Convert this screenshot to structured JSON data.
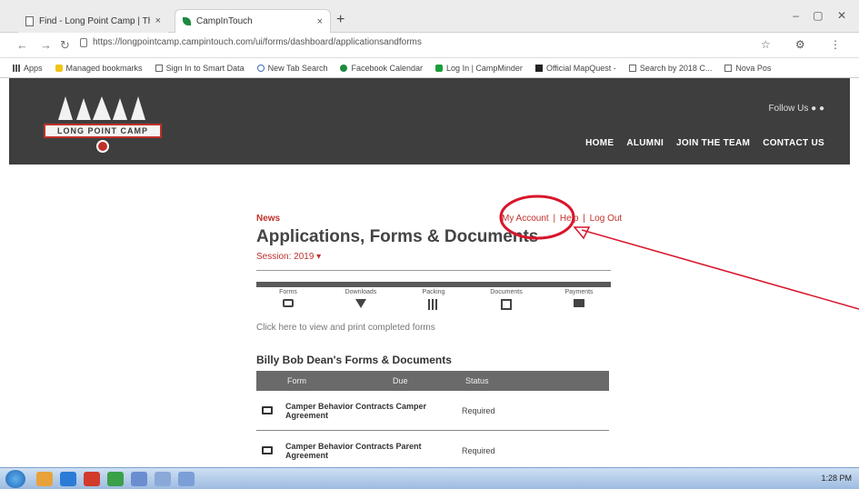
{
  "browser": {
    "tabs": [
      {
        "label": "Find - Long Point Camp | The"
      },
      {
        "label": "CampInTouch"
      }
    ],
    "url": "https://longpointcamp.campintouch.com/ui/forms/dashboard/applicationsandforms",
    "bookmarks": [
      {
        "label": "Apps",
        "icon": "apps-icon"
      },
      {
        "label": "Managed bookmarks",
        "icon": "folder-icon"
      },
      {
        "label": "Sign In to Smart Data",
        "icon": "doc-icon"
      },
      {
        "label": "New Tab Search",
        "icon": "search-icon"
      },
      {
        "label": "Facebook Calendar",
        "icon": "green-icon"
      },
      {
        "label": "Log In | CampMinder",
        "icon": "green-icon"
      },
      {
        "label": "Official MapQuest -",
        "icon": "map-icon"
      },
      {
        "label": "Search by 2018 C...",
        "icon": "doc-icon"
      },
      {
        "label": "Nova Pos",
        "icon": "doc-icon"
      }
    ]
  },
  "site": {
    "logo_text": "LONG POINT CAMP",
    "follow": "Follow Us",
    "nav": [
      "HOME",
      "ALUMNI",
      "JOIN THE TEAM",
      "CONTACT US"
    ]
  },
  "content": {
    "news": "News",
    "my_account": "My Account",
    "help": "Help",
    "logout": "Log Out",
    "sep": "|",
    "title": "Applications, Forms & Documents",
    "session": "Session: 2019",
    "icon_items": [
      {
        "label": "Forms",
        "icon": "monitor-icon"
      },
      {
        "label": "Downloads",
        "icon": "download-icon"
      },
      {
        "label": "Packing",
        "icon": "grid-icon"
      },
      {
        "label": "Documents",
        "icon": "document-icon"
      },
      {
        "label": "Payments",
        "icon": "card-icon"
      }
    ],
    "click_here_link": "Click here",
    "click_here_rest": "to view and print completed forms",
    "forms_title": "Billy Bob Dean's Forms & Documents",
    "table_headers": [
      "Form",
      "Due",
      "Status"
    ],
    "rows": [
      {
        "name": "Camper Behavior Contracts Camper Agreement",
        "status": "Required"
      },
      {
        "name": "Camper Behavior Contracts Parent Agreement",
        "status": "Required"
      }
    ]
  },
  "taskbar": {
    "tray": "1:28 PM"
  }
}
